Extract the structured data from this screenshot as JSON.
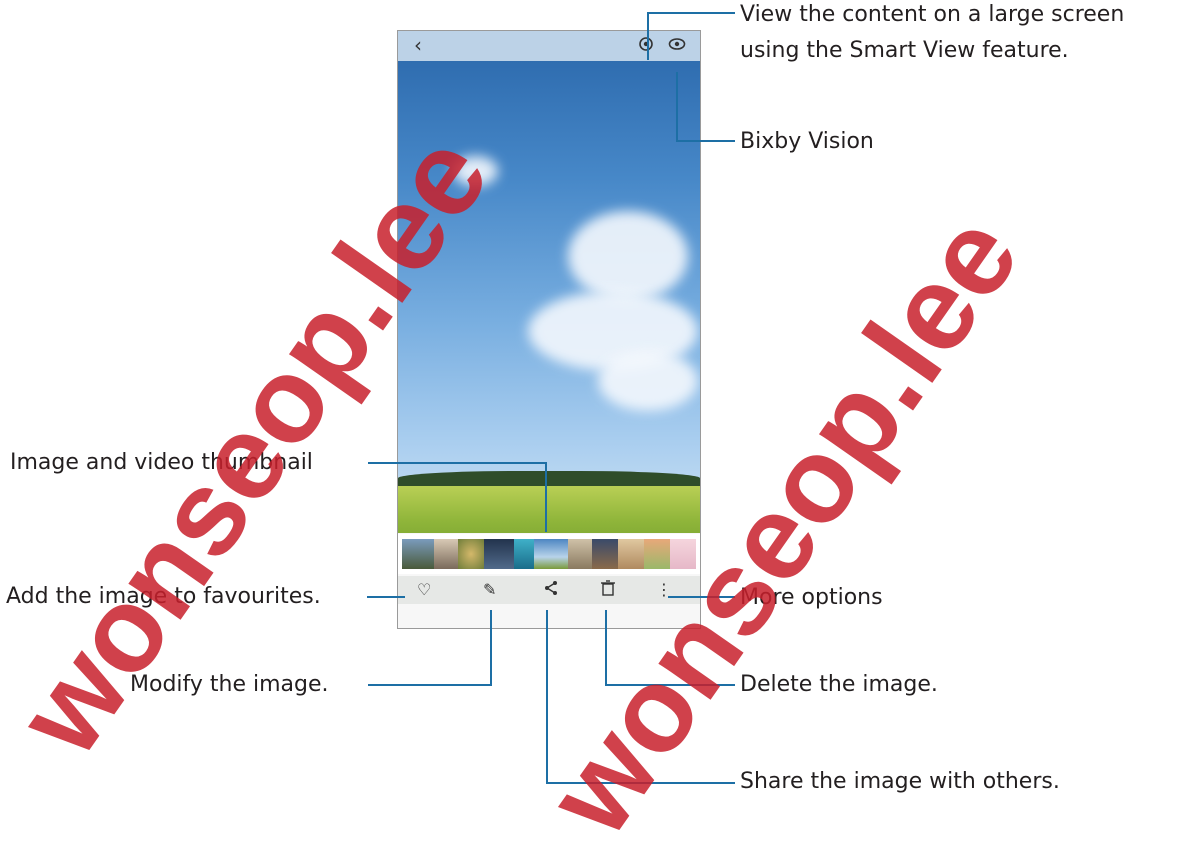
{
  "callouts": {
    "smart_view_line1": "View the content on a large screen",
    "smart_view_line2": "using the Smart View feature.",
    "bixby_vision": "Bixby Vision",
    "thumbnail": "Image and video thumbnail",
    "favourites": "Add the image to favourites.",
    "more_options": "More options",
    "modify": "Modify the image.",
    "delete": "Delete the image.",
    "share": "Share the image with others."
  },
  "watermark": {
    "text_a": "lee",
    "text_b": "seop",
    "text_c": "wonseop.lee"
  },
  "icons": {
    "back": "back-chevron-icon",
    "smart_view": "smart-view-icon",
    "bixby": "eye-icon",
    "heart": "heart-icon",
    "edit": "pencil-icon",
    "share": "share-icon",
    "delete": "trash-icon",
    "more": "more-vertical-icon"
  },
  "colors": {
    "callout_line": "#1d6fa5",
    "watermark": "#c8202c",
    "text": "#231f20"
  }
}
